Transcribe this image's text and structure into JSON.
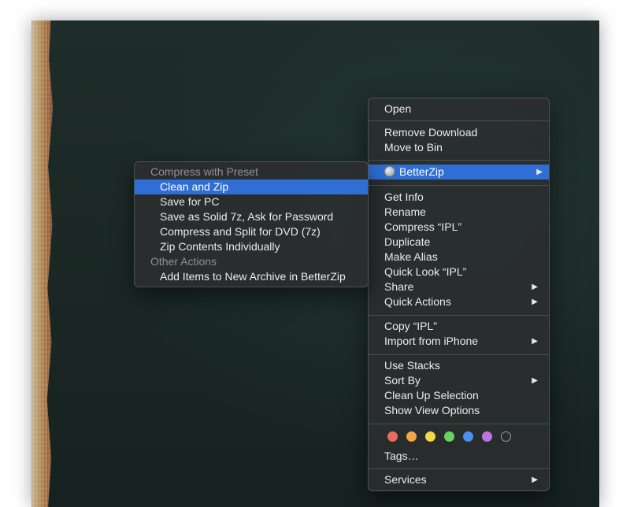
{
  "main_menu": {
    "groups": [
      [
        "Open"
      ],
      [
        "Remove Download",
        "Move to Bin"
      ],
      [
        "BetterZip"
      ],
      [
        "Get Info",
        "Rename",
        "Compress “IPL”",
        "Duplicate",
        "Make Alias",
        "Quick Look “IPL”",
        "Share",
        "Quick Actions"
      ],
      [
        "Copy “IPL”",
        "Import from iPhone"
      ],
      [
        "Use Stacks",
        "Sort By",
        "Clean Up Selection",
        "Show View Options"
      ],
      [
        "Tags…"
      ],
      [
        "Services"
      ]
    ],
    "open": "Open",
    "remove_download": "Remove Download",
    "move_to_bin": "Move to Bin",
    "betterzip": "BetterZip",
    "get_info": "Get Info",
    "rename": "Rename",
    "compress": "Compress “IPL”",
    "duplicate": "Duplicate",
    "make_alias": "Make Alias",
    "quick_look": "Quick Look “IPL”",
    "share": "Share",
    "quick_actions": "Quick Actions",
    "copy": "Copy “IPL”",
    "import_iphone": "Import from iPhone",
    "use_stacks": "Use Stacks",
    "sort_by": "Sort By",
    "clean_up": "Clean Up Selection",
    "show_view_options": "Show View Options",
    "tags": "Tags…",
    "services": "Services",
    "submenu_arrow": "▶"
  },
  "tag_colors": {
    "red": "#ec6a5e",
    "orange": "#f0a748",
    "yellow": "#f4d84a",
    "green": "#6ad25d",
    "blue": "#4d8ff0",
    "purple": "#c173e6",
    "none": "transparent"
  },
  "betterzip_submenu": {
    "header_preset": "Compress with Preset",
    "clean_and_zip": "Clean and Zip",
    "save_for_pc": "Save for PC",
    "save_solid_7z": "Save as Solid 7z, Ask for Password",
    "split_dvd": "Compress and Split for DVD (7z)",
    "zip_individually": "Zip Contents Individually",
    "header_other": "Other Actions",
    "add_to_archive": "Add Items to New Archive in BetterZip"
  },
  "colors": {
    "highlight": "#2f6ed4",
    "menu_bg": "#2a2e2f"
  }
}
